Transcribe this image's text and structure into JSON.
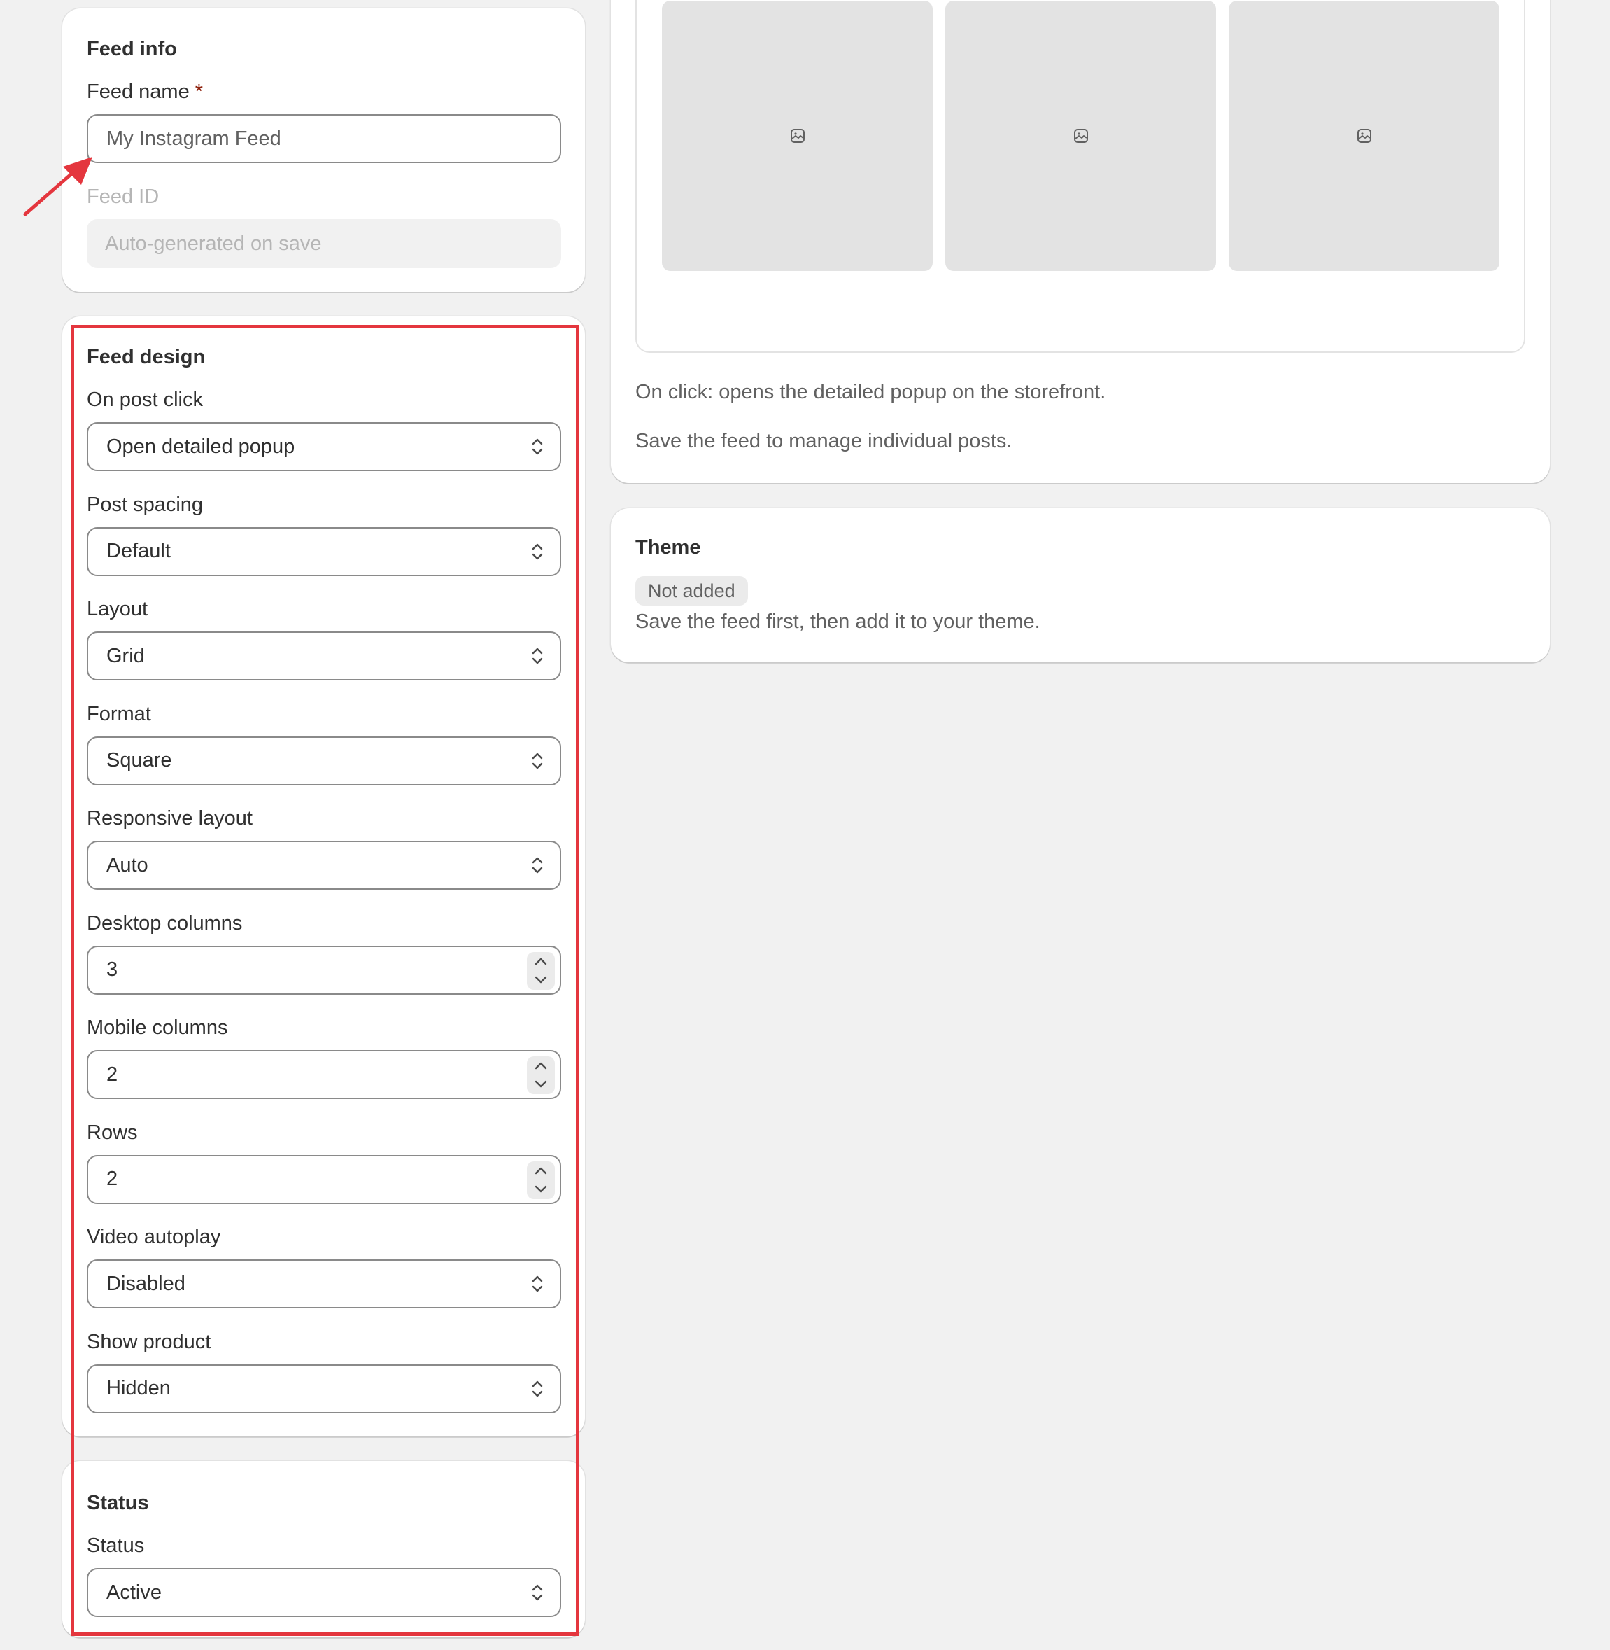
{
  "feed_info": {
    "title": "Feed info",
    "name_label": "Feed name",
    "required_mark": "*",
    "name_value": "My Instagram Feed",
    "id_label": "Feed ID",
    "id_placeholder": "Auto-generated on save"
  },
  "feed_design": {
    "title": "Feed design",
    "fields": [
      {
        "label": "On post click",
        "value": "Open detailed popup",
        "kind": "select"
      },
      {
        "label": "Post spacing",
        "value": "Default",
        "kind": "select"
      },
      {
        "label": "Layout",
        "value": "Grid",
        "kind": "select"
      },
      {
        "label": "Format",
        "value": "Square",
        "kind": "select"
      },
      {
        "label": "Responsive layout",
        "value": "Auto",
        "kind": "select"
      },
      {
        "label": "Desktop columns",
        "value": "3",
        "kind": "number"
      },
      {
        "label": "Mobile columns",
        "value": "2",
        "kind": "number"
      },
      {
        "label": "Rows",
        "value": "2",
        "kind": "number"
      },
      {
        "label": "Video autoplay",
        "value": "Disabled",
        "kind": "select"
      },
      {
        "label": "Show product",
        "value": "Hidden",
        "kind": "select"
      }
    ]
  },
  "status": {
    "title": "Status",
    "label": "Status",
    "value": "Active"
  },
  "preview": {
    "tile_icon": "image-icon",
    "on_click_text": "On click: opens the detailed popup on the storefront.",
    "manage_text": "Save the feed to manage individual posts."
  },
  "theme": {
    "title": "Theme",
    "badge": "Not added",
    "text": "Save the feed first, then add it to your theme."
  },
  "colors": {
    "annotation": "#e4363e",
    "background": "#f1f1f1",
    "tile": "#e3e3e3"
  }
}
